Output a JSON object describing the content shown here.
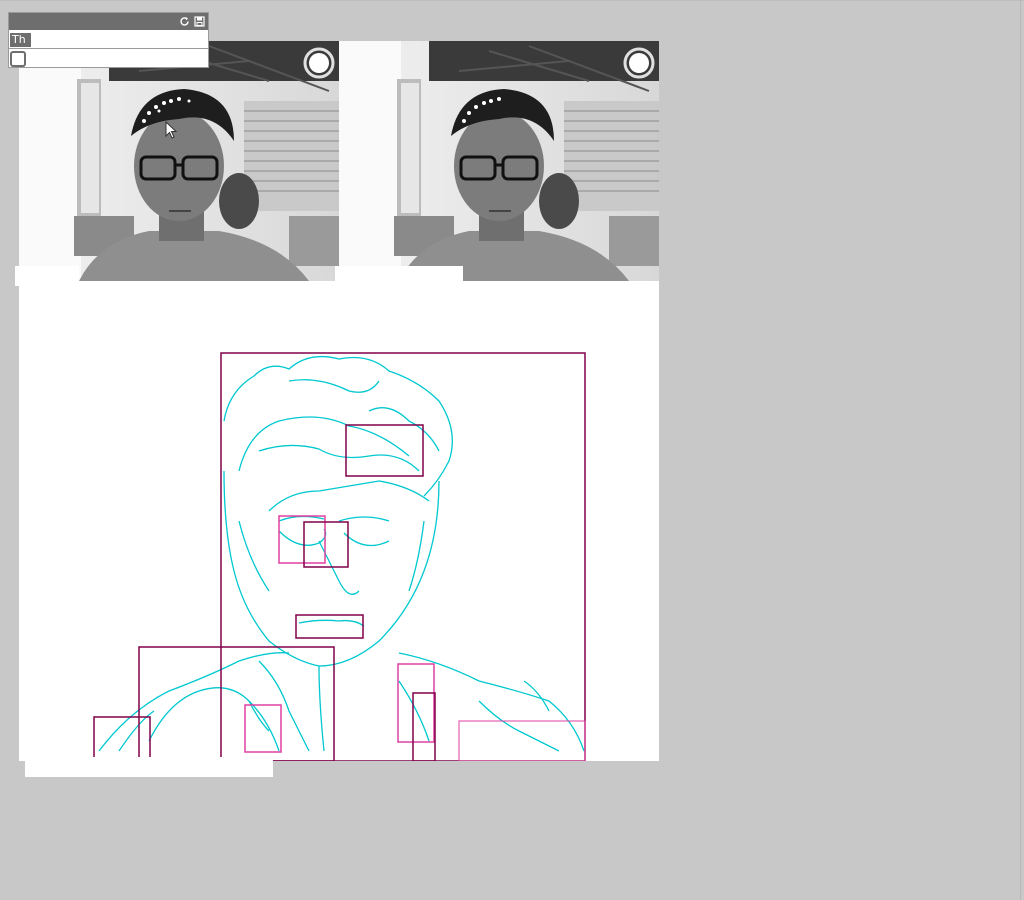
{
  "gui": {
    "text_value": "Th",
    "refresh_icon": "refresh-icon",
    "save_icon": "save-icon",
    "checkbox_checked": false
  },
  "colors": {
    "background": "#c8c8c8",
    "gui_header": "#6e6e6e",
    "edge_color": "#00d0d0",
    "box_dark": "#80004a",
    "box_light": "#e040a0"
  },
  "panels": {
    "video_left_label": "webcam-frame",
    "video_right_label": "processed-frame",
    "edge_canvas_label": "edge-detection-canvas"
  }
}
